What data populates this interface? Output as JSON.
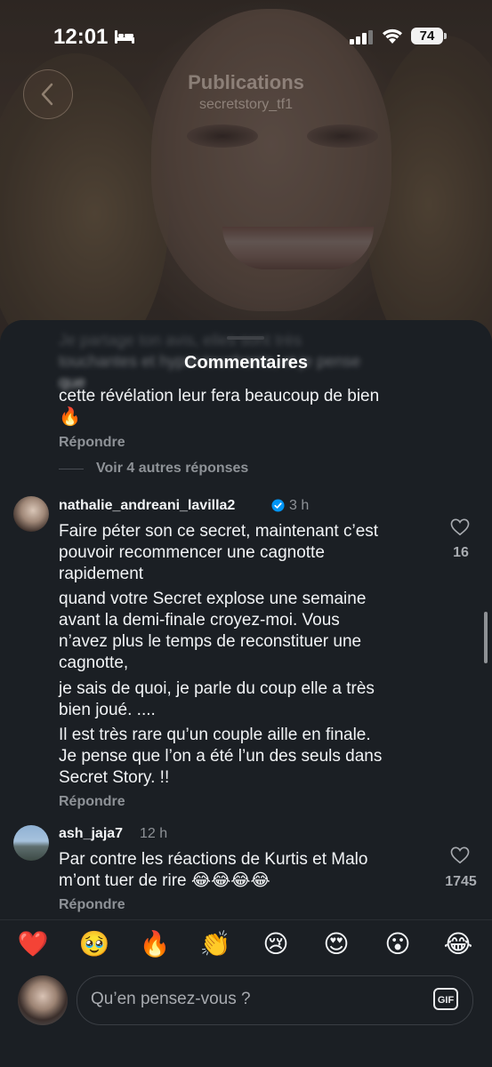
{
  "status_bar": {
    "time": "12:01",
    "battery": "74"
  },
  "header": {
    "title": "Publications",
    "subtitle": "secretstory_tf1"
  },
  "sheet": {
    "title": "Commentaires",
    "blurred_text": "Je partage ton avis, elles sont très touchantes et hyper touchants, et je pense que",
    "top_comment": {
      "line": "cette révélation leur fera beaucoup de bien",
      "emoji": "🔥",
      "reply": "Répondre",
      "more_replies": "Voir 4 autres réponses"
    },
    "comments": [
      {
        "username": "nathalie_andreani_lavilla2",
        "verified": true,
        "time": "3 h",
        "paragraphs": [
          [
            "Faire péter son ce secret, maintenant c’est",
            "pouvoir recommencer une cagnotte",
            "rapidement"
          ],
          [
            "quand votre Secret explose une semaine",
            "avant la demi-finale croyez-moi. Vous",
            "n’avez plus le temps de reconstituer une",
            "cagnotte,"
          ],
          [
            "je sais de quoi, je parle du coup elle a très",
            "bien joué. ...."
          ],
          [
            "Il est très rare qu’un couple aille en finale.",
            "Je pense que l’on a été l’un des seuls dans",
            "Secret Story. !!"
          ]
        ],
        "likes": "16",
        "reply": "Répondre"
      },
      {
        "username": "ash_jaja7",
        "verified": false,
        "time": "12 h",
        "paragraphs": [
          [
            "Par contre les réactions de Kurtis et Malo",
            "m’ont tuer de rire 😂😂😂😂"
          ]
        ],
        "likes": "1745",
        "reply": "Répondre"
      }
    ]
  },
  "emoji_bar": [
    "❤️",
    "🥹",
    "🔥",
    "👏",
    "😢",
    "😍",
    "😮",
    "😂"
  ],
  "composer": {
    "placeholder": "Qu’en pensez-vous ?",
    "gif_label": "GIF"
  },
  "colors": {
    "sheet_bg": "#1b1f24",
    "muted": "#8e9297",
    "verified": "#0095f6"
  }
}
